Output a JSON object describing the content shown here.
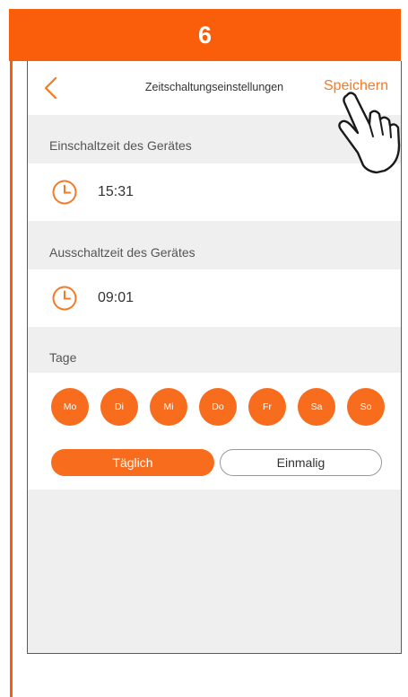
{
  "step": {
    "number": "6"
  },
  "topbar": {
    "back_icon": "chevron-left-icon",
    "title": "Zeitschaltungseinstellungen",
    "save_label": "Speichern"
  },
  "on_time": {
    "label": "Einschaltzeit des Gerätes",
    "value": "15:31",
    "icon": "clock-icon"
  },
  "off_time": {
    "label": "Ausschaltzeit des Gerätes",
    "value": "09:01",
    "icon": "clock-icon"
  },
  "days": {
    "label": "Tage",
    "items": [
      "Mo",
      "Di",
      "Mi",
      "Do",
      "Fr",
      "Sa",
      "So"
    ]
  },
  "frequency": {
    "daily_label": "Täglich",
    "once_label": "Einmalig",
    "selected": "Täglich"
  },
  "annotation": {
    "icon": "pointing-hand-icon"
  },
  "colors": {
    "accent": "#fb5e0a",
    "chip": "#f86c1e",
    "background": "#efefef",
    "panel": "#ffffff",
    "text": "#333333"
  }
}
